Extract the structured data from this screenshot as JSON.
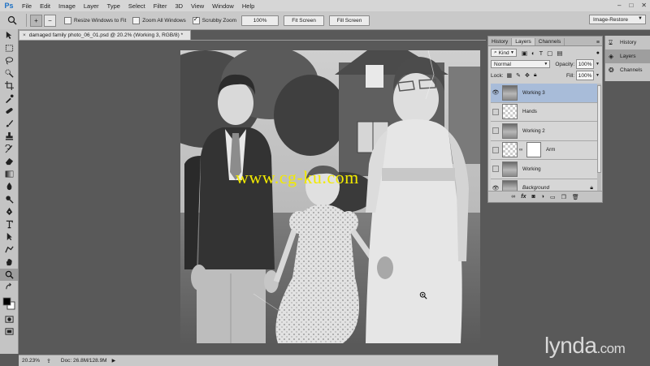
{
  "app": {
    "logo": "Ps",
    "menu": [
      "File",
      "Edit",
      "Image",
      "Layer",
      "Type",
      "Select",
      "Filter",
      "3D",
      "View",
      "Window",
      "Help"
    ],
    "window_controls": [
      "–",
      "□",
      "✕"
    ]
  },
  "options_bar": {
    "zoom_in": "+",
    "zoom_out": "−",
    "resize_windows_to_fit": {
      "label": "Resize Windows to Fit",
      "checked": false
    },
    "zoom_all_windows": {
      "label": "Zoom All Windows",
      "checked": false
    },
    "scrubby_zoom": {
      "label": "Scrubby Zoom",
      "checked": true
    },
    "buttons": [
      "100%",
      "Fit Screen",
      "Fill Screen"
    ],
    "workspace": "Image-Restore"
  },
  "document": {
    "tab_title": "damaged family photo_06_01.psd @ 20.2% (Working 3, RGB/8) *",
    "close": "×"
  },
  "status": {
    "zoom": "20.23%",
    "doc_size": "Doc: 26.8M/128.9M"
  },
  "layers_panel": {
    "tabs": [
      "History",
      "Layers",
      "Channels"
    ],
    "active_tab": "Layers",
    "kind_label": "Kind",
    "blend_mode": "Normal",
    "opacity_label": "Opacity:",
    "opacity": "100%",
    "lock_label": "Lock:",
    "fill_label": "Fill:",
    "fill": "100%",
    "layers": [
      {
        "name": "Working 3",
        "visible": true,
        "selected": true,
        "thumb": "photo"
      },
      {
        "name": "Hands",
        "visible": false,
        "selected": false,
        "thumb": "transparent"
      },
      {
        "name": "Working 2",
        "visible": false,
        "selected": false,
        "thumb": "photo"
      },
      {
        "name": "Arm",
        "visible": false,
        "selected": false,
        "thumb": "transparent",
        "mask": true
      },
      {
        "name": "Working",
        "visible": false,
        "selected": false,
        "thumb": "photo"
      },
      {
        "name": "Background",
        "visible": true,
        "selected": false,
        "thumb": "photo",
        "locked": true
      }
    ],
    "footer_icons": [
      "link-icon",
      "fx-icon",
      "mask-icon",
      "adjustment-icon",
      "folder-icon",
      "new-layer-icon",
      "trash-icon"
    ]
  },
  "dock": {
    "items": [
      {
        "label": "History",
        "icon": "history-icon"
      },
      {
        "label": "Layers",
        "icon": "layers-icon"
      },
      {
        "label": "Channels",
        "icon": "channels-icon"
      }
    ]
  },
  "overlays": {
    "watermark": "www.cg-ku.com",
    "brand": "lynda",
    "brand_suffix": ".com"
  },
  "colors": {
    "selected_layer": "#a8bcd9",
    "watermark": "#f2ea00",
    "canvas_bg": "#595959"
  }
}
